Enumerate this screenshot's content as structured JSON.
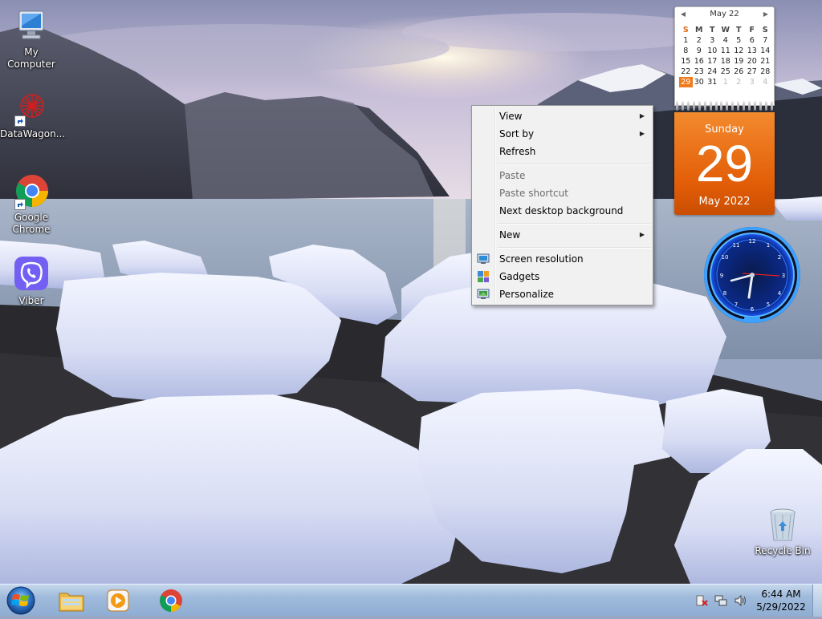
{
  "desktop": {
    "icons": [
      {
        "label": "My Computer",
        "icon": "computer-icon"
      },
      {
        "label": "DataWagon...",
        "icon": "datawagon-icon"
      },
      {
        "label": "Google Chrome",
        "icon": "chrome-icon"
      },
      {
        "label": "Viber",
        "icon": "viber-icon"
      },
      {
        "label": "Recycle Bin",
        "icon": "recycle-bin-icon"
      }
    ]
  },
  "calendar": {
    "month_header": "May 22",
    "weekdays": [
      "S",
      "M",
      "T",
      "W",
      "T",
      "F",
      "S"
    ],
    "weeks": [
      [
        "1",
        "2",
        "3",
        "4",
        "5",
        "6",
        "7"
      ],
      [
        "8",
        "9",
        "10",
        "11",
        "12",
        "13",
        "14"
      ],
      [
        "15",
        "16",
        "17",
        "18",
        "19",
        "20",
        "21"
      ],
      [
        "22",
        "23",
        "24",
        "25",
        "26",
        "27",
        "28"
      ],
      [
        "29",
        "30",
        "31",
        "1",
        "2",
        "3",
        "4"
      ]
    ],
    "day_name": "Sunday",
    "day_number": "29",
    "month_year": "May 2022",
    "accent_color": "#e8660e"
  },
  "context_menu": {
    "items": [
      {
        "label": "View",
        "submenu": true,
        "enabled": true
      },
      {
        "label": "Sort by",
        "submenu": true,
        "enabled": true
      },
      {
        "label": "Refresh",
        "submenu": false,
        "enabled": true
      },
      {
        "label": "Paste",
        "submenu": false,
        "enabled": false
      },
      {
        "label": "Paste shortcut",
        "submenu": false,
        "enabled": false
      },
      {
        "label": "Next desktop background",
        "submenu": false,
        "enabled": true
      },
      {
        "label": "New",
        "submenu": true,
        "enabled": true
      },
      {
        "label": "Screen resolution",
        "submenu": false,
        "enabled": true,
        "icon": "screen-resolution-icon"
      },
      {
        "label": "Gadgets",
        "submenu": false,
        "enabled": true,
        "icon": "gadgets-icon"
      },
      {
        "label": "Personalize",
        "submenu": false,
        "enabled": true,
        "icon": "personalize-icon"
      }
    ]
  },
  "taskbar": {
    "pinned": [
      "file-explorer-icon",
      "media-player-icon",
      "chrome-icon"
    ],
    "tray_icons": [
      "action-center-icon",
      "network-icon",
      "volume-icon"
    ],
    "time": "6:44 AM",
    "date": "5/29/2022"
  }
}
